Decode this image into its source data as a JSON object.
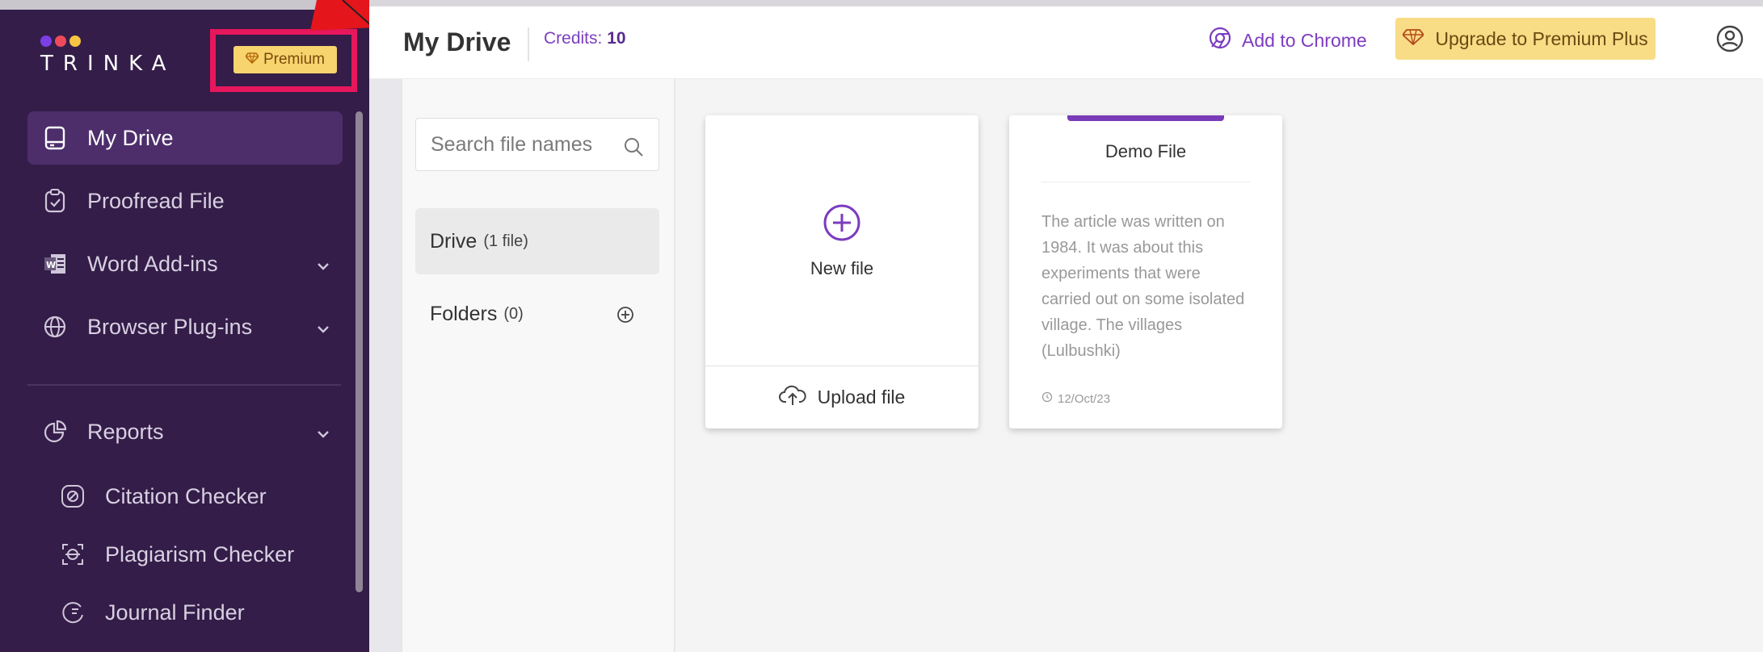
{
  "brand": {
    "name": "TRINKA",
    "dots": [
      "#7b3fe4",
      "#ef4a5c",
      "#f6c343"
    ]
  },
  "premium_badge": {
    "label": "Premium",
    "icon": "diamond-icon"
  },
  "sidebar": {
    "items": [
      {
        "label": "My Drive",
        "icon": "drive-icon",
        "active": true
      },
      {
        "label": "Proofread File",
        "icon": "clipboard-icon"
      },
      {
        "label": "Word Add-ins",
        "icon": "word-icon",
        "expandable": true
      },
      {
        "label": "Browser Plug-ins",
        "icon": "globe-icon",
        "expandable": true
      }
    ],
    "reports": {
      "label": "Reports",
      "icon": "reports-icon",
      "expandable": true
    },
    "sub_items": [
      {
        "label": "Citation Checker",
        "icon": "citation-icon"
      },
      {
        "label": "Plagiarism Checker",
        "icon": "plagiarism-icon"
      },
      {
        "label": "Journal Finder",
        "icon": "journal-icon"
      }
    ]
  },
  "header": {
    "title": "My Drive",
    "credits_label": "Credits:",
    "credits_value": "10",
    "add_chrome": "Add to Chrome",
    "upgrade": "Upgrade to Premium Plus"
  },
  "files_panel": {
    "search_placeholder": "Search file names",
    "drive_label": "Drive",
    "drive_count": "(1 file)",
    "folders_label": "Folders",
    "folders_count": "(0)"
  },
  "cards": {
    "new_file": "New file",
    "upload_file": "Upload file",
    "demo": {
      "title": "Demo File",
      "preview": "The article was written on 1984. It was about this experiments that were carried out on some isolated village. The villages (Lulbushki)",
      "date": "12/Oct/23"
    }
  },
  "colors": {
    "accent": "#7b3fbf",
    "sidebar": "#341d48",
    "highlight": "#e6175c",
    "upgrade": "#f8dc86"
  }
}
